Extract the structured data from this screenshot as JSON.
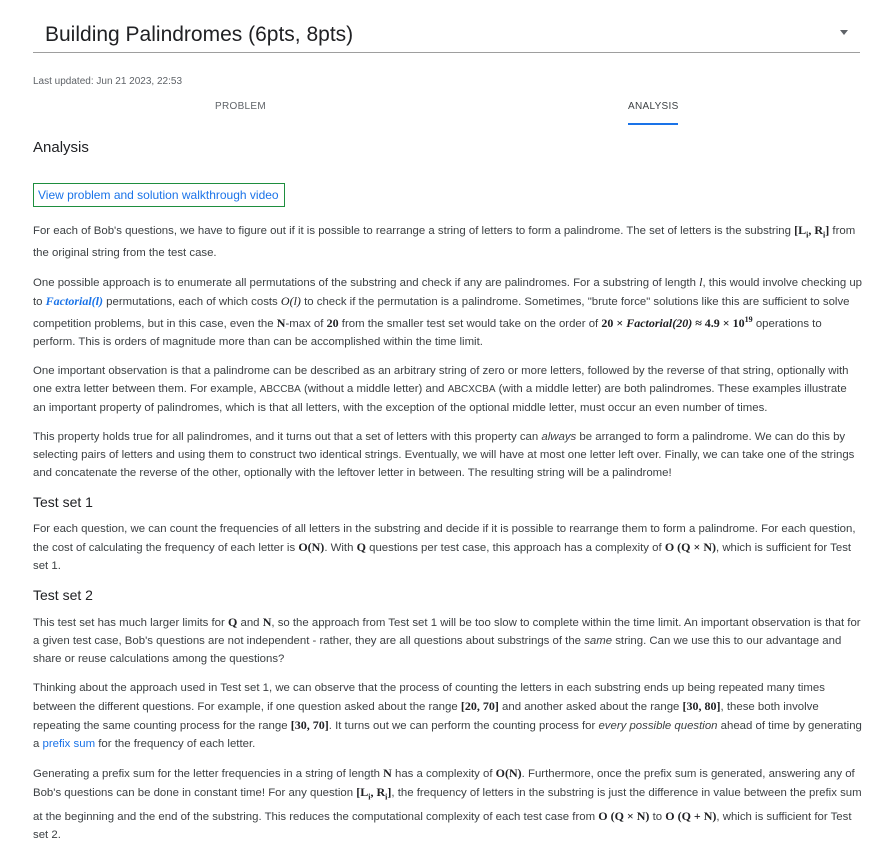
{
  "header": {
    "title": "Building Palindromes (6pts, 8pts)",
    "updated": "Last updated: Jun 21 2023, 22:53"
  },
  "tabs": [
    "PROBLEM",
    "ANALYSIS"
  ],
  "analysis": {
    "heading": "Analysis",
    "video_label": "View problem and solution walkthrough video",
    "p1": {
      "a": "For each of Bob's questions, we have to figure out if it is possible to rearrange a string of letters to form a palindrome. The set of letters is the substring",
      "b": "from the original string from the test case."
    },
    "p2": {
      "a": "One possible approach is to enumerate all permutations of the substring and check if any are palindromes. For a substring of length",
      "b": ", this would involve checking up to",
      "c": "permutations, each of which costs",
      "d": "to check if the permutation is a palindrome. Sometimes, \"brute force\" solutions like this are sufficient to solve competition problems, but in this case, even the",
      "e": "-max of",
      "f": "from the smaller test set would take on the order of",
      "g": "operations to perform. This is orders of magnitude more than can be accomplished within the time limit."
    },
    "p3": {
      "a": "One important observation is that a palindrome can be described as an arbitrary string of zero or more letters, followed by the reverse of that string, optionally with one extra letter between them. For example,",
      "ex1": "ABCCBA",
      "b": "(without a middle letter) and",
      "ex2": "ABCXCBA",
      "c": "(with a middle letter) are both palindromes. These examples illustrate an important property of palindromes, which is that all letters, with the exception of the optional middle letter, must occur an even number of times."
    },
    "p4": {
      "a": "This property holds true for all palindromes, and it turns out that a set of letters with this property can",
      "em": "always",
      "b": "be arranged to form a palindrome. We can do this by selecting pairs of letters and using them to construct two identical strings. Eventually, we will have at most one letter left over. Finally, we can take one of the strings and concatenate the reverse of the other, optionally with the leftover letter in between. The resulting string will be a palindrome!"
    },
    "ts1": {
      "heading": "Test set 1",
      "a": "For each question, we can count the frequencies of all letters in the substring and decide if it is possible to rearrange them to form a palindrome. For each question, the cost of calculating the frequency of each letter is",
      "b": ". With",
      "c": "questions per test case, this approach has a complexity of",
      "d": ", which is sufficient for Test set 1."
    },
    "ts2": {
      "heading": "Test set 2",
      "p1": {
        "a": "This test set has much larger limits for",
        "b": "and",
        "c": ", so the approach from Test set 1 will be too slow to complete within the time limit. An important observation is that for a given test case, Bob's questions are not independent - rather, they are all questions about substrings of the",
        "em": "same",
        "d": "string. Can we use this to our advantage and share or reuse calculations among the questions?"
      },
      "p2": {
        "a": "Thinking about the approach used in Test set 1, we can observe that the process of counting the letters in each substring ends up being repeated many times between the different questions. For example, if one question asked about the range",
        "b": "and another asked about the range",
        "c": ", these both involve repeating the same counting process for the range",
        "d": ". It turns out we can perform the counting process for",
        "em": "every possible question",
        "e": "ahead of time by generating a",
        "link": "prefix sum",
        "f": "for the frequency of each letter."
      },
      "p3": {
        "a": "Generating a prefix sum for the letter frequencies in a string of length",
        "b": "has a complexity of",
        "c": ". Furthermore, once the prefix sum is generated, answering any of Bob's questions can be done in constant time! For any question",
        "d": ", the frequency of letters in the substring is just the difference in value between the prefix sum at the beginning and the end of the substring. This reduces the computational complexity of each test case from",
        "e": "to",
        "f": ", which is sufficient for Test set 2."
      }
    },
    "math": {
      "li_ri": "[L",
      "i_sub": "i",
      "comma": ", R",
      "close": "]",
      "l": "l",
      "factorial_l": "Factorial(l)",
      "ol": "O(l)",
      "N": "N",
      "twenty": "20",
      "ops_a": "20 × ",
      "ops_fact": "Factorial(20)",
      "ops_b": " ≈ 4.9 × 10",
      "ops_exp": "19",
      "ON": "O(N)",
      "Q": "Q",
      "OQN": "O (Q × N)",
      "r1": "[20, 70]",
      "r2": "[30, 80]",
      "r3": "[30, 70]",
      "OQpN": "O (Q + N)"
    }
  }
}
